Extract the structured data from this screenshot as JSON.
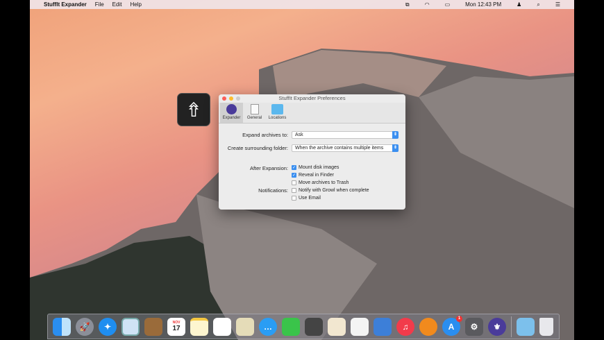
{
  "menubar": {
    "app": "StuffIt Expander",
    "items": [
      "File",
      "Edit",
      "Help"
    ],
    "clock": "Mon 12:43 PM"
  },
  "window": {
    "title": "StuffIt Expander Preferences",
    "tabs": [
      "Expander",
      "General",
      "Locations"
    ],
    "expand_label": "Expand archives to:",
    "expand_value": "Ask",
    "folder_label": "Create surrounding folder:",
    "folder_value": "When the archive contains multiple items",
    "after_label": "After Expansion:",
    "notif_label": "Notifications:",
    "checks": [
      {
        "label": "Mount disk images",
        "checked": true
      },
      {
        "label": "Reveal in Finder",
        "checked": true
      },
      {
        "label": "Move archives to Trash",
        "checked": false
      },
      {
        "label": "Notify with Growl when complete",
        "checked": false
      },
      {
        "label": "Use Email",
        "checked": false
      }
    ]
  },
  "dock": {
    "calendar_month": "NOV",
    "calendar_day": "17",
    "appstore_badge": "1",
    "apps": [
      "Finder",
      "Launchpad",
      "Safari",
      "Mail",
      "Contacts",
      "Calendar",
      "Notes",
      "Reminders",
      "Maps",
      "Messages",
      "FaceTime",
      "Photo Booth",
      "Pages",
      "Numbers",
      "Keynote",
      "iTunes",
      "iBooks",
      "App Store",
      "System Preferences",
      "StuffIt Expander",
      "Downloads",
      "Trash"
    ]
  }
}
